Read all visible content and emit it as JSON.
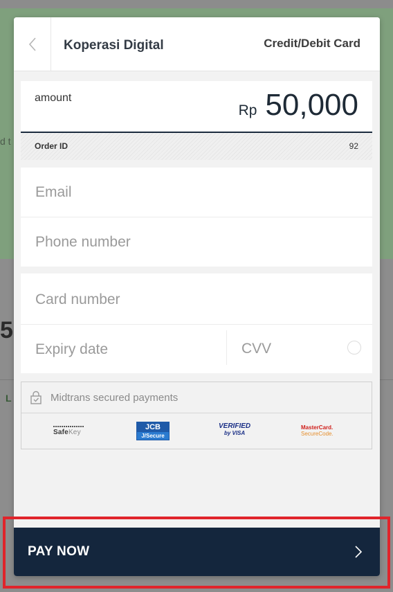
{
  "background": {
    "snippet_left": "d t",
    "snippet_big": "5.",
    "snippet_small": "L"
  },
  "header": {
    "merchant": "Koperasi Digital",
    "method": "Credit/Debit Card",
    "back_icon": "chevron-left-icon"
  },
  "amount": {
    "label": "amount",
    "currency": "Rp",
    "value": "50,000"
  },
  "order": {
    "label": "Order ID",
    "value": "92"
  },
  "contact": {
    "email_placeholder": "Email",
    "phone_placeholder": "Phone number"
  },
  "card": {
    "number_placeholder": "Card number",
    "expiry_placeholder": "Expiry date",
    "cvv_placeholder": "CVV"
  },
  "security": {
    "text": "Midtrans secured payments",
    "icon": "lock-icon",
    "logos": {
      "safekey_main": "Safe",
      "safekey_sub": "Key",
      "jcb_top": "JCB",
      "jcb_bottom": "J/Secure",
      "visa_top": "VERIFIED",
      "visa_bottom": "by VISA",
      "mc_top": "MasterCard.",
      "mc_bottom": "SecureCode."
    }
  },
  "pay": {
    "label": "PAY NOW",
    "icon": "chevron-right-icon"
  },
  "colors": {
    "primary_dark": "#14263d",
    "highlight": "#e0242b",
    "modal_bg": "#f2f2f2"
  }
}
